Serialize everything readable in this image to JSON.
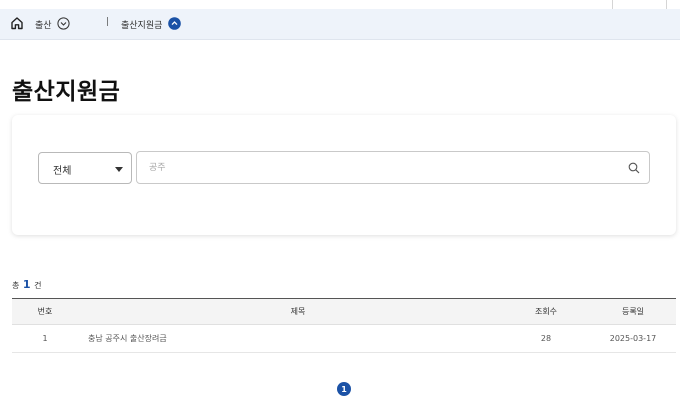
{
  "breadcrumb": {
    "level1": "출산",
    "separator": "|",
    "level2": "출산지원금"
  },
  "page": {
    "title": "출산지원금"
  },
  "search": {
    "category_selected": "전체",
    "input_value": "공주",
    "placeholder": "공주"
  },
  "results": {
    "count_prefix": "총",
    "count": "1",
    "count_suffix": "건"
  },
  "table": {
    "headers": {
      "no": "번호",
      "title": "제목",
      "views": "조회수",
      "date": "등록일"
    },
    "rows": [
      {
        "no": "1",
        "title": "충남 공주시 출산장려금",
        "views": "28",
        "date": "2025-03-17"
      }
    ]
  },
  "pagination": {
    "current": "1"
  },
  "colors": {
    "accent": "#1b52a6",
    "breadcrumb_bg": "#eef3fa"
  },
  "icons": {
    "home": "home-icon",
    "chevron_down": "chevron-down-circle-icon",
    "chevron_up": "chevron-up-circle-icon",
    "dropdown_caret": "caret-down-icon",
    "search": "search-icon"
  }
}
